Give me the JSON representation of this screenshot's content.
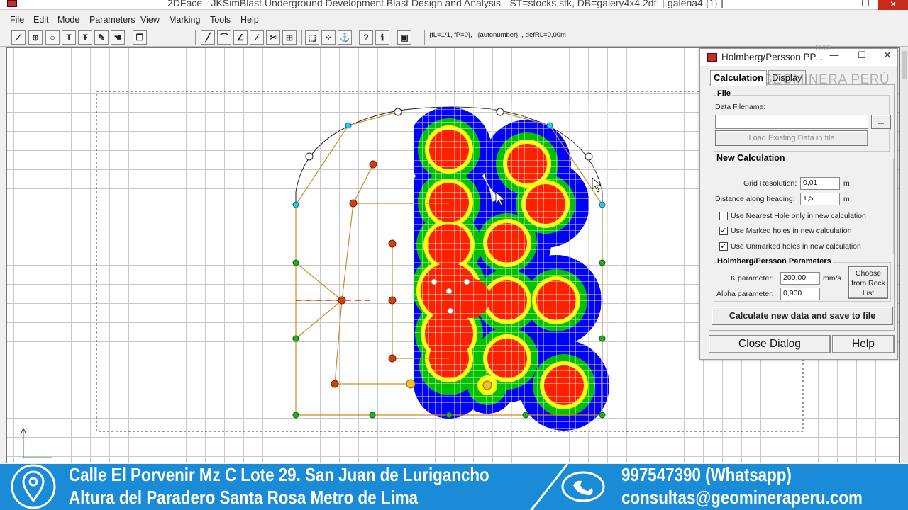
{
  "window": {
    "title": "2DFace - JKSimBlast Underground Development Blast Design and Analysis - ST=stocks.stk, DB=galery4x4.2df: [ galeria4 {1} ]",
    "controls": {
      "minimize": "—",
      "maximize": "☐",
      "close": "✕"
    }
  },
  "menu": [
    "File",
    "Edit",
    "Mode",
    "Parameters",
    "View",
    "Marking",
    "Tools",
    "Help"
  ],
  "toolbar": {
    "status": "{fL=1/1, fP=0}, '-{autonumber}-', defRL=0,00m",
    "groups": [
      [
        "line-tool-icon",
        "add-hole-icon",
        "circle-tool-icon",
        "text-tool-icon",
        "text-alt-icon",
        "pen-icon",
        "hand-icon",
        "copy-icon"
      ],
      [
        "draw-line-icon",
        "polyline-icon",
        "angle-icon",
        "scale-xyz-icon",
        "cut-icon"
      ],
      [
        "select-box-icon",
        "select-multi-icon",
        "anchor-icon",
        "help-pointer-icon",
        "info-icon",
        "window-icon"
      ]
    ]
  },
  "dialog": {
    "title": "Holmberg/Persson PP...",
    "tabs": [
      "Calculation",
      "Display"
    ],
    "file": {
      "group_label": "File",
      "data_filename_label": "Data Filename:",
      "data_filename_value": "",
      "browse_label": "...",
      "load_button": "Load Existing Data in file"
    },
    "new_calc": {
      "group_label": "New Calculation",
      "grid_resolution_label": "Grid Resolution:",
      "grid_resolution_value": "0,01",
      "grid_resolution_unit": "m",
      "distance_label": "Distance along heading:",
      "distance_value": "1,5",
      "distance_unit": "m",
      "checkboxes": [
        {
          "label": "Use Nearest Hole only in new calculation",
          "checked": false
        },
        {
          "label": "Use Marked holes in new calculation",
          "checked": true
        },
        {
          "label": "Use Unmarked holes in new calculation",
          "checked": true
        }
      ]
    },
    "hp_params": {
      "group_label": "Holmberg/Persson Parameters",
      "k_label": "K  parameter:",
      "k_value": "200,00",
      "k_unit": "mm/s",
      "alpha_label": "Alpha  parameter:",
      "alpha_value": "0,900",
      "choose_button": "Choose from Rock List"
    },
    "calculate_button": "Calculate new data and save to file",
    "close_button": "Close Dialog",
    "help_button": "Help"
  },
  "watermark": {
    "text": "GEOMINERA PERÚ",
    "small": "R&R"
  },
  "banner": {
    "address_line1": "Calle El Porvenir Mz C Lote 29. San Juan de Lurigancho",
    "address_line2": "Altura del Paradero Santa Rosa Metro de Lima",
    "phone": "997547390  (Whatsapp)",
    "email": "consultas@geomineraperu.com"
  },
  "colors": {
    "ppv_low": "#0000ff",
    "ppv_mid": "#00c000",
    "ppv_high": "#ffff00",
    "ppv_max": "#ff2000",
    "banner": "#1a8bd6"
  }
}
